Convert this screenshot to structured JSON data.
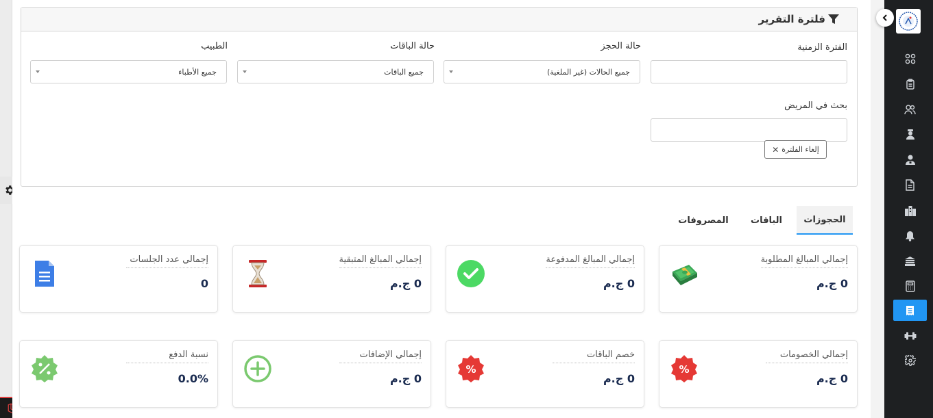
{
  "filter": {
    "title": "فلترة التقرير",
    "period_label": "الفترة الزمنية",
    "booking_status_label": "حالة الحجز",
    "booking_status_value": "جميع الحالات (غير الملغية)",
    "packages_status_label": "حالة الباقات",
    "packages_status_value": "جميع الباقات",
    "doctor_label": "الطبيب",
    "doctor_value": "جميع الأطباء",
    "patient_search_label": "بحث في المريض",
    "clear_button": "إلغاء الفلترة"
  },
  "tabs": [
    {
      "label": "الحجوزات",
      "active": true
    },
    {
      "label": "الباقات",
      "active": false
    },
    {
      "label": "المصروفات",
      "active": false
    }
  ],
  "cards": [
    {
      "title": "إجمالي المبالغ المطلوبة",
      "value": "0 ج.م",
      "icon": "money-icon"
    },
    {
      "title": "إجمالي المبالغ المدفوعة",
      "value": "0 ج.م",
      "icon": "check-circle-icon"
    },
    {
      "title": "إجمالي المبالغ المتبقية",
      "value": "0 ج.م",
      "icon": "hourglass-icon"
    },
    {
      "title": "إجمالي عدد الجلسات",
      "value": "0",
      "icon": "document-icon"
    },
    {
      "title": "إجمالي الخصومات",
      "value": "0 ج.م",
      "icon": "discount-badge-icon"
    },
    {
      "title": "خصم الباقات",
      "value": "0 ج.م",
      "icon": "discount-badge-icon"
    },
    {
      "title": "إجمالي الإضافات",
      "value": "0 ج.م",
      "icon": "plus-circle-icon"
    },
    {
      "title": "نسبة الدفع",
      "value": "0.0%",
      "icon": "percent-badge-icon"
    }
  ],
  "sidebar": {
    "items": [
      {
        "icon": "dashboard-grid-icon"
      },
      {
        "icon": "clipboard-icon"
      },
      {
        "icon": "users-icon"
      },
      {
        "icon": "doctor-icon"
      },
      {
        "icon": "staff-icon"
      },
      {
        "icon": "file-icon"
      },
      {
        "icon": "building-icon"
      },
      {
        "icon": "bell-icon"
      },
      {
        "icon": "bank-icon"
      },
      {
        "icon": "calculator-icon"
      },
      {
        "icon": "receipt-icon",
        "active": true
      },
      {
        "icon": "dumbbell-icon"
      },
      {
        "icon": "settings-icon"
      }
    ]
  },
  "colors": {
    "accent": "#2196f3",
    "sidebar_bg": "#1e2022",
    "value_text": "#1a2b50",
    "check_green": "#4cd964",
    "discount_red": "#e53935",
    "percent_green": "#7bc96f"
  }
}
